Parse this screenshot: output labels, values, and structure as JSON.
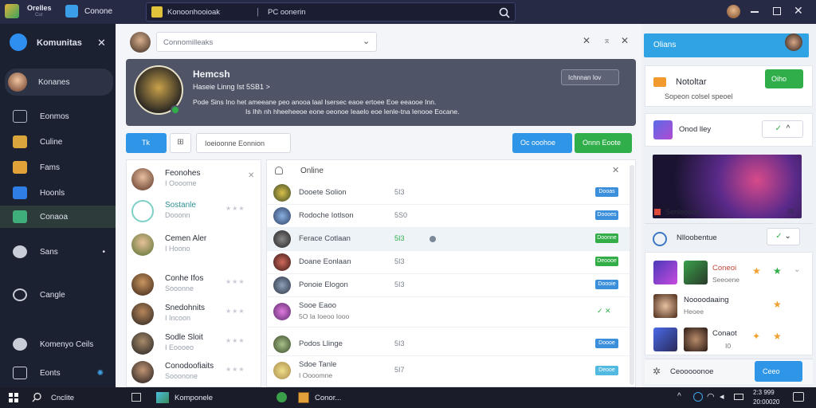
{
  "app": {
    "logo_line1": "Orelles",
    "logo_line2": "Cur",
    "tab_title": "Conone"
  },
  "search": {
    "tab_label": "Konoonhooioak",
    "divider": "|",
    "query": "PC oonerin"
  },
  "sidebar": {
    "title": "Komunitas",
    "items": [
      {
        "label": "Konanes",
        "active": true
      },
      {
        "label": "Eonmos"
      },
      {
        "label": "Culine"
      },
      {
        "label": "Fams"
      },
      {
        "label": "Hoonls"
      },
      {
        "label": "Conaoa"
      },
      {
        "label": "Sans"
      },
      {
        "label": "Cangle"
      },
      {
        "label": "Komenyo Ceils"
      },
      {
        "label": "Eonts"
      }
    ]
  },
  "main": {
    "dropdown_value": "Connomilleaks",
    "hero": {
      "name": "Hemcsh",
      "line1": "Haseie Linng Ist 5SB1 >",
      "line2": "Pode Sins Ino het ameeane peo anooa laal Isersec eaoe ertoee Eoe eeaooe Inn.",
      "line3": "Is Ihh nh hheeheeoe eone oeonoe Ieaelo eoe lenle-tna Ienooe Eocane.",
      "badge_label": "Ichnnan Iov"
    },
    "toolbar": {
      "tab_label": "Tk",
      "search_label": "Ioeioonne Eonnion",
      "btn1": "Oc ooohoe",
      "btn2": "Onnn Eoote"
    },
    "friends": [
      {
        "name": "Feonohes",
        "sub": "I Oooome"
      },
      {
        "name": "Sostanle",
        "sub": "Dooonn"
      },
      {
        "name": "Cemen Aler",
        "sub": "I Hoono"
      },
      {
        "name": "Conhe Ifos",
        "sub": "Sooonne"
      },
      {
        "name": "Snedohnits",
        "sub": "I Incoon"
      },
      {
        "name": "Sodle Sloit",
        "sub": "I Eoooeo"
      },
      {
        "name": "Conodoofiaits",
        "sub": "Sooonone"
      }
    ],
    "online": {
      "title": "Online",
      "rows": [
        {
          "name": "Dooete Solion",
          "num": "5I3",
          "btn": "Dooas",
          "color": "#3b8fdb"
        },
        {
          "name": "Rodoche Iotlson",
          "num": "5S0",
          "btn": "Doooes",
          "color": "#3b8fdb"
        },
        {
          "name": "Ferace Cotlaan",
          "num": "5I3",
          "btn": "Doonne",
          "color": "#33ad48"
        },
        {
          "name": "Doane Eonlaan",
          "num": "5I3",
          "btn": "Deoooe",
          "color": "#33ad48"
        },
        {
          "name": "Ponoie Elogon",
          "num": "5I3",
          "btn": "Doooie",
          "color": "#3b8fdb"
        },
        {
          "name": "Sooe Eaoo",
          "sub": "5O Ia Ioeoo Iooo",
          "num": "",
          "btn": "",
          "color": ""
        },
        {
          "name": "Podos Llinge",
          "num": "5I3",
          "btn": "Doooe",
          "color": "#3b8fdb"
        },
        {
          "name": "Sdoe Tanle",
          "sub": "I Oooomne",
          "num": "5I7",
          "btn": "Deooe",
          "color": "#52b9e0"
        }
      ]
    }
  },
  "right": {
    "header": "Olians",
    "notif_title": "Notoltar",
    "notif_sub": "Sopeon colsel speoel",
    "notif_btn": "Oiho",
    "row2": "Onod lley",
    "game_caption": "Senleoone",
    "game_num": "I3",
    "row3": "Nlloobentue",
    "players": [
      {
        "name": "Coneoi",
        "sub": "Seeoene"
      },
      {
        "name": "Noooodaaing",
        "sub": "Heoee"
      },
      {
        "name": "Conaot",
        "sub": "I0"
      }
    ],
    "footer": "Ceooooonoe",
    "footer_btn": "Ceeo"
  },
  "taskbar": {
    "search": "Cnclite",
    "app1": "Komponele",
    "app2": "Conor...",
    "time": "2:3 999",
    "date": "20:00020"
  },
  "colors": {
    "accent_blue": "#2f95e6",
    "accent_green": "#2fae4a"
  }
}
